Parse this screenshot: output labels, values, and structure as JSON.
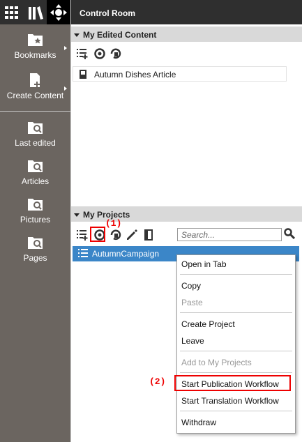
{
  "main_header": {
    "title": "Control Room"
  },
  "sidebar": {
    "items": [
      {
        "label": "Bookmarks"
      },
      {
        "label": "Create Content"
      },
      {
        "label": "Last edited"
      },
      {
        "label": "Articles"
      },
      {
        "label": "Pictures"
      },
      {
        "label": "Pages"
      }
    ]
  },
  "edited": {
    "title": "My Edited Content",
    "rows": [
      {
        "label": "Autumn Dishes Article"
      }
    ]
  },
  "projects": {
    "title": "My Projects",
    "search_placeholder": "Search...",
    "rows": [
      {
        "label": "AutumnCampaign"
      }
    ]
  },
  "annotations": {
    "one": "(1)",
    "two": "(2)"
  },
  "context_menu": {
    "items": [
      {
        "label": "Open in Tab",
        "enabled": true
      },
      {
        "label": "Copy",
        "enabled": true
      },
      {
        "label": "Paste",
        "enabled": false
      },
      {
        "label": "Create Project",
        "enabled": true
      },
      {
        "label": "Leave",
        "enabled": true
      },
      {
        "label": "Add to My Projects",
        "enabled": false
      },
      {
        "label": "Start Publication Workflow",
        "enabled": true
      },
      {
        "label": "Start Translation Workflow",
        "enabled": true
      },
      {
        "label": "Withdraw",
        "enabled": true
      }
    ]
  },
  "colors": {
    "selection": "#3b86c8",
    "annotation": "#ee0000",
    "sidebar": "#6b6560",
    "topbar": "#2f2f2f"
  }
}
